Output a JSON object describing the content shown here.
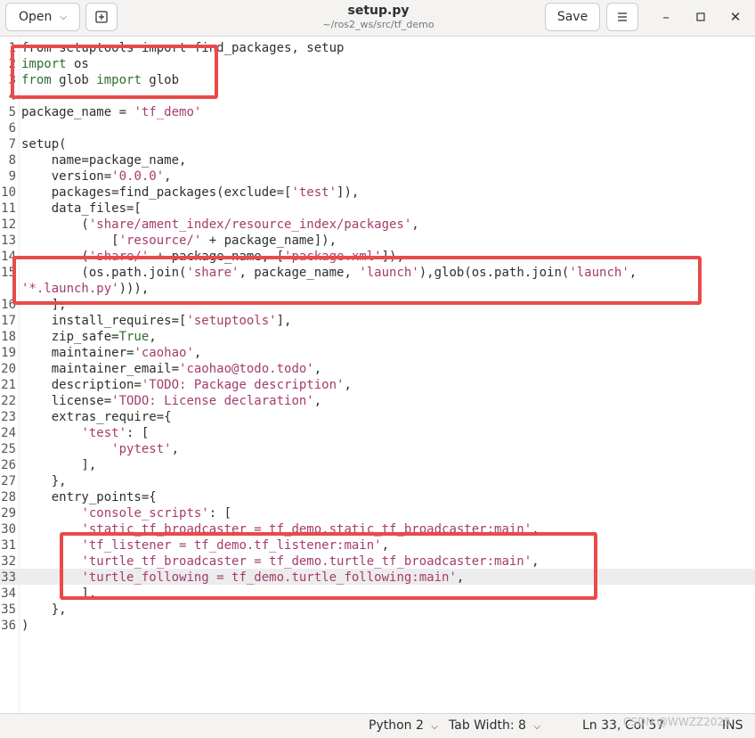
{
  "header": {
    "open_label": "Open",
    "title": "setup.py",
    "subtitle": "~/ros2_ws/src/tf_demo",
    "save_label": "Save"
  },
  "editor": {
    "current_line": 33,
    "lines": [
      {
        "n": "1",
        "segs": [
          [
            "plain",
            "from setuptools import find_packages, setup"
          ]
        ]
      },
      {
        "n": "2",
        "segs": [
          [
            "kw",
            "import"
          ],
          [
            "plain",
            " os"
          ]
        ]
      },
      {
        "n": "3",
        "segs": [
          [
            "kw",
            "from"
          ],
          [
            "plain",
            " glob "
          ],
          [
            "kw",
            "import"
          ],
          [
            "plain",
            " glob"
          ]
        ]
      },
      {
        "n": "4",
        "segs": []
      },
      {
        "n": "5",
        "segs": [
          [
            "plain",
            "package_name = "
          ],
          [
            "str",
            "'tf_demo'"
          ]
        ]
      },
      {
        "n": "6",
        "segs": []
      },
      {
        "n": "7",
        "segs": [
          [
            "plain",
            "setup("
          ]
        ]
      },
      {
        "n": "8",
        "segs": [
          [
            "plain",
            "    name=package_name,"
          ]
        ]
      },
      {
        "n": "9",
        "segs": [
          [
            "plain",
            "    version="
          ],
          [
            "str",
            "'0.0.0'"
          ],
          [
            "plain",
            ","
          ]
        ]
      },
      {
        "n": "10",
        "segs": [
          [
            "plain",
            "    packages=find_packages(exclude=["
          ],
          [
            "str",
            "'test'"
          ],
          [
            "plain",
            "]),"
          ]
        ]
      },
      {
        "n": "11",
        "segs": [
          [
            "plain",
            "    data_files=["
          ]
        ]
      },
      {
        "n": "12",
        "segs": [
          [
            "plain",
            "        ("
          ],
          [
            "str",
            "'share/ament_index/resource_index/packages'"
          ],
          [
            "plain",
            ","
          ]
        ]
      },
      {
        "n": "13",
        "segs": [
          [
            "plain",
            "            ["
          ],
          [
            "str",
            "'resource/'"
          ],
          [
            "plain",
            " + package_name]),"
          ]
        ]
      },
      {
        "n": "14",
        "segs": [
          [
            "plain",
            "        ("
          ],
          [
            "str",
            "'share/'"
          ],
          [
            "plain",
            " + package_name, ["
          ],
          [
            "str",
            "'package.xml'"
          ],
          [
            "plain",
            "]),"
          ]
        ]
      },
      {
        "n": "15",
        "segs": [
          [
            "plain",
            "        (os.path.join("
          ],
          [
            "str",
            "'share'"
          ],
          [
            "plain",
            ", package_name, "
          ],
          [
            "str",
            "'launch'"
          ],
          [
            "plain",
            "),glob(os.path.join("
          ],
          [
            "str",
            "'launch'"
          ],
          [
            "plain",
            ","
          ]
        ]
      },
      {
        "n": "",
        "segs": [
          [
            "str",
            "'*.launch.py'"
          ],
          [
            "plain",
            ")))"
          ],
          [
            "plain",
            ","
          ]
        ]
      },
      {
        "n": "16",
        "segs": [
          [
            "plain",
            "    ],"
          ]
        ]
      },
      {
        "n": "17",
        "segs": [
          [
            "plain",
            "    install_requires=["
          ],
          [
            "str",
            "'setuptools'"
          ],
          [
            "plain",
            "],"
          ]
        ]
      },
      {
        "n": "18",
        "segs": [
          [
            "plain",
            "    zip_safe="
          ],
          [
            "kw",
            "True"
          ],
          [
            "plain",
            ","
          ]
        ]
      },
      {
        "n": "19",
        "segs": [
          [
            "plain",
            "    maintainer="
          ],
          [
            "str",
            "'caohao'"
          ],
          [
            "plain",
            ","
          ]
        ]
      },
      {
        "n": "20",
        "segs": [
          [
            "plain",
            "    maintainer_email="
          ],
          [
            "str",
            "'caohao@todo.todo'"
          ],
          [
            "plain",
            ","
          ]
        ]
      },
      {
        "n": "21",
        "segs": [
          [
            "plain",
            "    description="
          ],
          [
            "str",
            "'TODO: Package description'"
          ],
          [
            "plain",
            ","
          ]
        ]
      },
      {
        "n": "22",
        "segs": [
          [
            "plain",
            "    license="
          ],
          [
            "str",
            "'TODO: License declaration'"
          ],
          [
            "plain",
            ","
          ]
        ]
      },
      {
        "n": "23",
        "segs": [
          [
            "plain",
            "    extras_require={"
          ]
        ]
      },
      {
        "n": "24",
        "segs": [
          [
            "plain",
            "        "
          ],
          [
            "str",
            "'test'"
          ],
          [
            "plain",
            ": ["
          ]
        ]
      },
      {
        "n": "25",
        "segs": [
          [
            "plain",
            "            "
          ],
          [
            "str",
            "'pytest'"
          ],
          [
            "plain",
            ","
          ]
        ]
      },
      {
        "n": "26",
        "segs": [
          [
            "plain",
            "        ],"
          ]
        ]
      },
      {
        "n": "27",
        "segs": [
          [
            "plain",
            "    },"
          ]
        ]
      },
      {
        "n": "28",
        "segs": [
          [
            "plain",
            "    entry_points={"
          ]
        ]
      },
      {
        "n": "29",
        "segs": [
          [
            "plain",
            "        "
          ],
          [
            "str",
            "'console_scripts'"
          ],
          [
            "plain",
            ": ["
          ]
        ]
      },
      {
        "n": "30",
        "segs": [
          [
            "plain",
            "        "
          ],
          [
            "str",
            "'static_tf_broadcaster = tf_demo.static_tf_broadcaster:main'"
          ],
          [
            "plain",
            ","
          ]
        ]
      },
      {
        "n": "31",
        "segs": [
          [
            "plain",
            "        "
          ],
          [
            "str",
            "'tf_listener = tf_demo.tf_listener:main'"
          ],
          [
            "plain",
            ","
          ]
        ]
      },
      {
        "n": "32",
        "segs": [
          [
            "plain",
            "        "
          ],
          [
            "str",
            "'turtle_tf_broadcaster = tf_demo.turtle_tf_broadcaster:main'"
          ],
          [
            "plain",
            ","
          ]
        ]
      },
      {
        "n": "33",
        "segs": [
          [
            "plain",
            "        "
          ],
          [
            "str",
            "'turtle_following = tf_demo.turtle_following:main'"
          ],
          [
            "plain",
            ","
          ]
        ]
      },
      {
        "n": "34",
        "segs": [
          [
            "plain",
            "        ],"
          ]
        ]
      },
      {
        "n": "35",
        "segs": [
          [
            "plain",
            "    },"
          ]
        ]
      },
      {
        "n": "36",
        "segs": [
          [
            "plain",
            ")"
          ]
        ]
      }
    ]
  },
  "statusbar": {
    "language": "Python 2",
    "tab_width": "Tab Width: 8",
    "position": "Ln 33, Col 57",
    "mode": "INS",
    "watermark": "CSDN @WWZZ2025"
  },
  "colors": {
    "highlight_box": "#e94a4a",
    "string": "#a53b6e",
    "keyword": "#2f6f2f"
  },
  "icons": [
    "new-tab-icon",
    "hamburger-menu-icon",
    "minimize-icon",
    "maximize-icon",
    "close-icon",
    "chevron-down-icon"
  ]
}
